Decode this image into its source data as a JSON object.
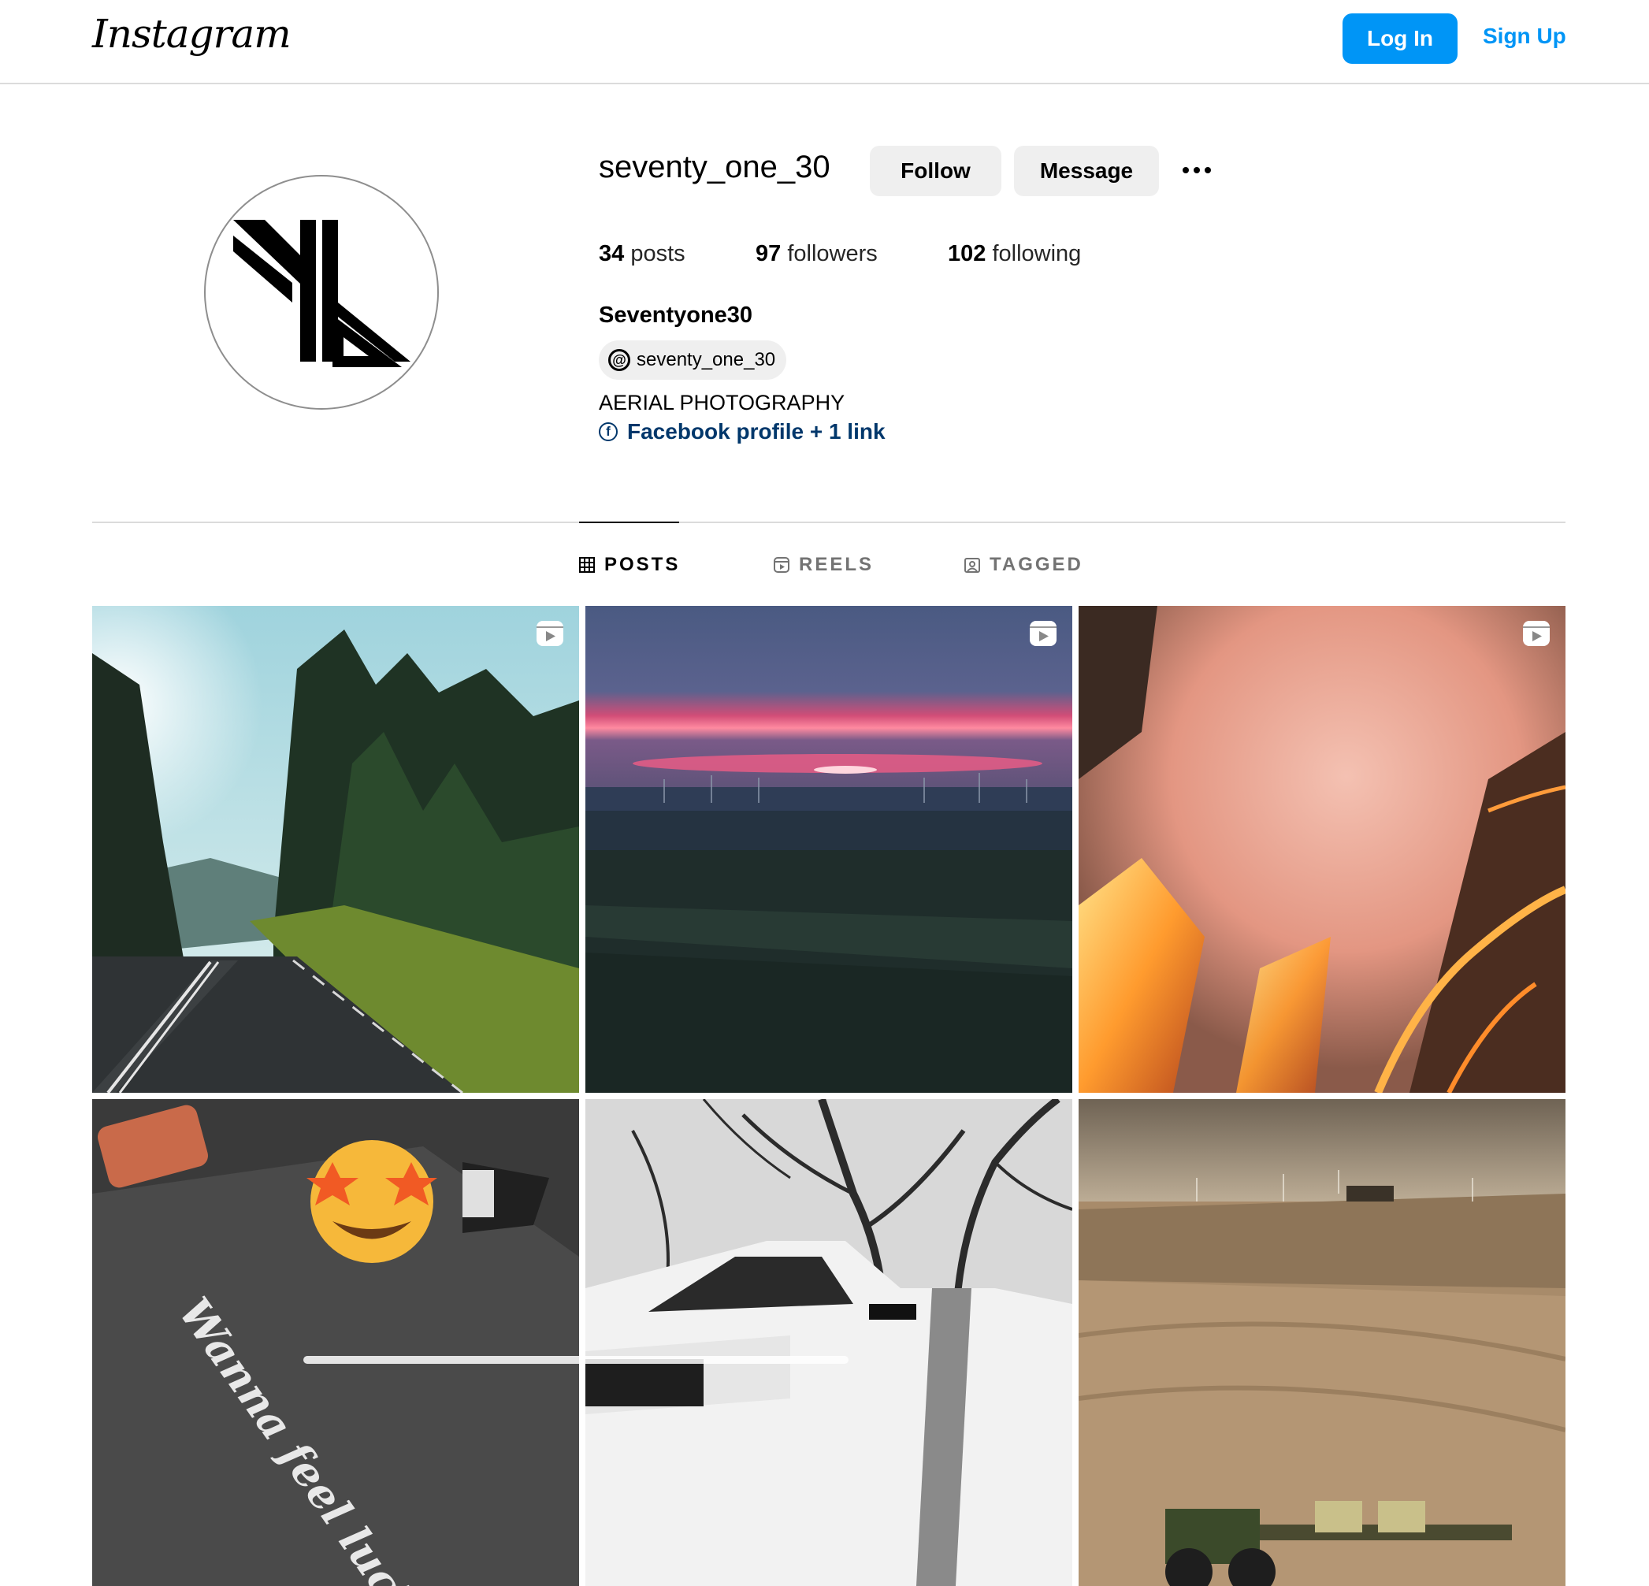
{
  "header": {
    "logo": "Instagram",
    "login_label": "Log In",
    "signup_label": "Sign Up"
  },
  "profile": {
    "username": "seventy_one_30",
    "follow_label": "Follow",
    "message_label": "Message",
    "posts_count": "34",
    "posts_label": "posts",
    "followers_count": "97",
    "followers_label": "followers",
    "following_count": "102",
    "following_label": "following",
    "full_name": "Seventyone30",
    "threads_handle": "seventy_one_30",
    "bio": "AERIAL PHOTOGRAPHY",
    "links_label": "Facebook profile + 1 link"
  },
  "tabs": [
    {
      "label": "POSTS",
      "icon": "grid-icon",
      "active": true
    },
    {
      "label": "REELS",
      "icon": "reels-icon",
      "active": false
    },
    {
      "label": "TAGGED",
      "icon": "tagged-icon",
      "active": false
    }
  ],
  "posts": [
    {
      "subject": "forest road",
      "is_reel": true
    },
    {
      "subject": "prairie sunset with wind turbines",
      "is_reel": true
    },
    {
      "subject": "aerial prairie fire",
      "is_reel": true
    },
    {
      "subject": "grey shirt with star-eyes emoji",
      "is_reel": false
    },
    {
      "subject": "white pickup truck under bare trees",
      "is_reel": false
    },
    {
      "subject": "tractor planting field",
      "is_reel": false
    }
  ],
  "post_overlay_text": {
    "shirt_text": "Wanna feel lucky"
  },
  "colors": {
    "primary_blue": "#0095f6",
    "link_blue": "#00376b",
    "button_grey": "#efefef",
    "divider": "#dbdbdb"
  }
}
